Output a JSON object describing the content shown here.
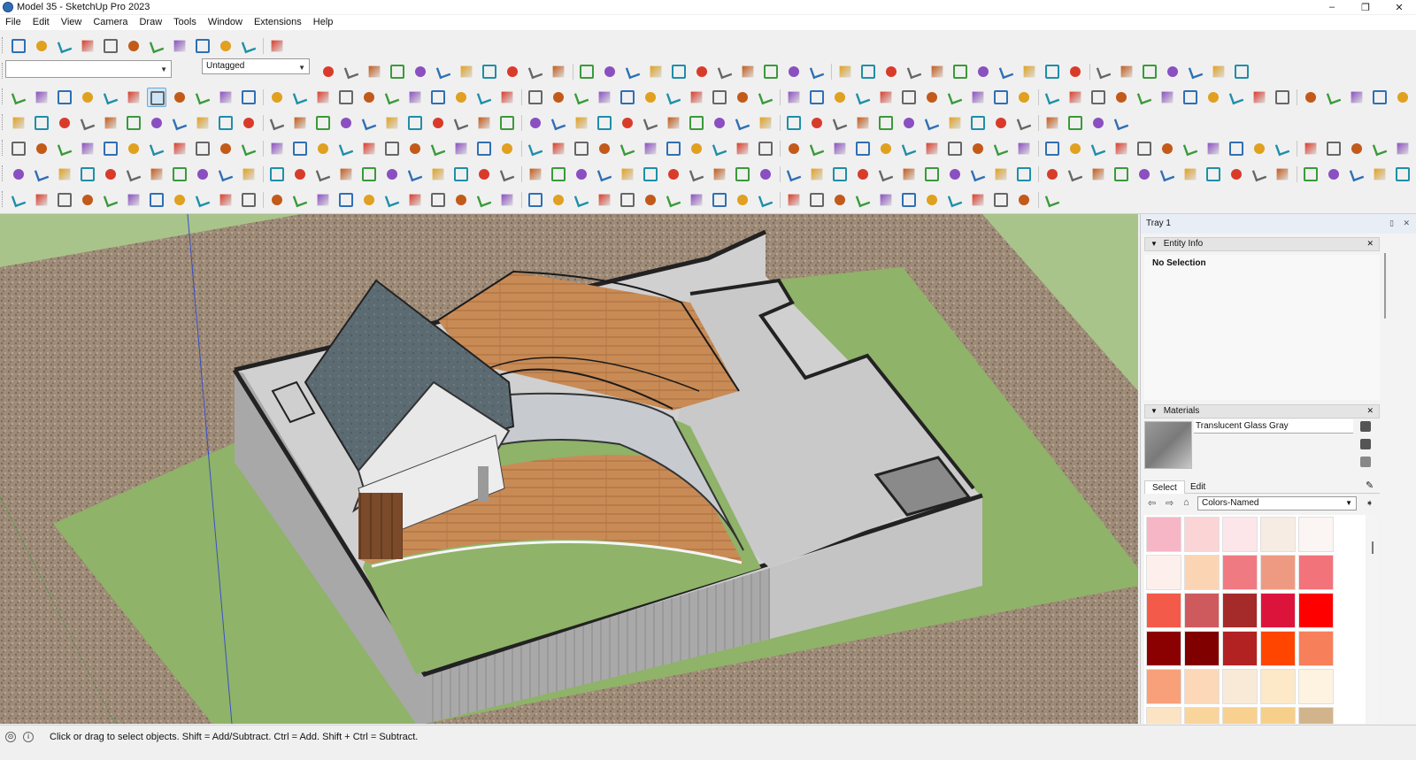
{
  "window": {
    "title": "Model 35 - SketchUp Pro 2023",
    "minimize": "–",
    "maximize": "❐",
    "close": "✕"
  },
  "menu": [
    "File",
    "Edit",
    "View",
    "Camera",
    "Draw",
    "Tools",
    "Window",
    "Extensions",
    "Help"
  ],
  "toolbar": {
    "tag_select": "Untagged",
    "layer_value": ""
  },
  "tray": {
    "title": "Tray 1",
    "entity_info": {
      "title": "Entity Info",
      "selection": "No Selection"
    },
    "materials": {
      "title": "Materials",
      "current": "Translucent Glass Gray",
      "tabs": [
        "Select",
        "Edit"
      ],
      "library": "Colors-Named",
      "swatches": [
        "#f7b6c6",
        "#fbd4d6",
        "#fce6ea",
        "#f7ece3",
        "#fbf5f3",
        "#fdf0ec",
        "#fbd5b3",
        "#f07a82",
        "#ee9a82",
        "#f3737a",
        "#f45a4a",
        "#cf5a5e",
        "#a52a2a",
        "#dc143c",
        "#ff0000",
        "#8b0000",
        "#800000",
        "#b22222",
        "#ff4500",
        "#f77f5a",
        "#f7a07a",
        "#fcd8b8",
        "#f9ead8",
        "#fde8c8",
        "#fdf3e0",
        "#fbe3c3",
        "#f9d59b",
        "#f8d090",
        "#f6d08a",
        "#d2b48c"
      ]
    }
  },
  "status": {
    "hint": "Click or drag to select objects. Shift = Add/Subtract. Ctrl = Add. Shift + Ctrl = Subtract."
  },
  "colors": {
    "accent": "#2f6fb5",
    "grass": "#8fb369",
    "sky": "#a8c48a",
    "gravel": "#9b8a78"
  }
}
